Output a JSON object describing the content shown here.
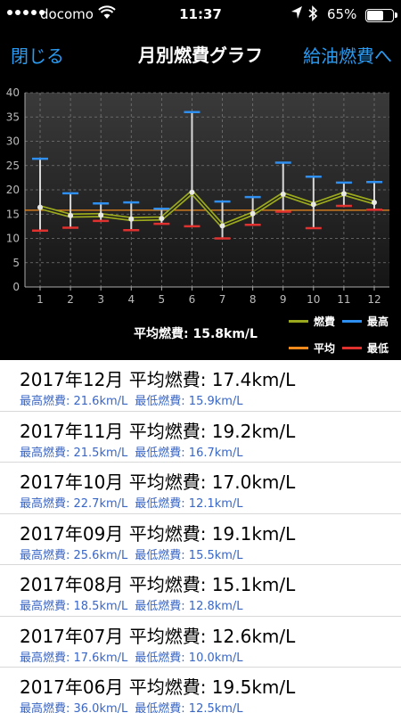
{
  "status": {
    "carrier": "docomo",
    "time": "11:37",
    "battery": "65%",
    "battery_level": 0.65
  },
  "nav": {
    "close_label": "閉じる",
    "title": "月別燃費グラフ",
    "fuel_label": "給油燃費へ"
  },
  "chart_data": {
    "type": "line",
    "categories": [
      "1",
      "2",
      "3",
      "4",
      "5",
      "6",
      "7",
      "8",
      "9",
      "10",
      "11",
      "12"
    ],
    "ylim": [
      0,
      40
    ],
    "yticks": [
      0,
      5,
      10,
      15,
      20,
      25,
      30,
      35,
      40
    ],
    "average": 15.8,
    "series": [
      {
        "name": "燃費",
        "values": [
          16.4,
          14.7,
          14.8,
          14.0,
          14.1,
          19.5,
          12.6,
          15.1,
          19.1,
          17.0,
          19.2,
          17.4
        ],
        "color": "#9aa81e"
      },
      {
        "name": "最高",
        "values": [
          26.4,
          19.3,
          17.2,
          17.4,
          16.1,
          36.0,
          17.6,
          18.5,
          25.6,
          22.7,
          21.5,
          21.6
        ],
        "color": "#2f8ff0"
      },
      {
        "name": "最低",
        "values": [
          11.6,
          12.2,
          13.6,
          11.7,
          13.0,
          12.5,
          10.0,
          12.8,
          15.5,
          12.1,
          16.7,
          15.9
        ],
        "color": "#e0312f"
      }
    ],
    "average_color": "#f08a1c",
    "grid": true,
    "legend_position": "bottom-right"
  },
  "legend": {
    "avg_text": "平均燃費: 15.8km/L",
    "items": {
      "fuel": "燃費",
      "max": "最高",
      "avg": "平均",
      "min": "最低"
    }
  },
  "months": [
    {
      "head": "2017年12月 平均燃費: 17.4km/L",
      "max": "最高燃費: 21.6km/L",
      "min": "最低燃費: 15.9km/L"
    },
    {
      "head": "2017年11月 平均燃費: 19.2km/L",
      "max": "最高燃費: 21.5km/L",
      "min": "最低燃費: 16.7km/L"
    },
    {
      "head": "2017年10月 平均燃費: 17.0km/L",
      "max": "最高燃費: 22.7km/L",
      "min": "最低燃費: 12.1km/L"
    },
    {
      "head": "2017年09月 平均燃費: 19.1km/L",
      "max": "最高燃費: 25.6km/L",
      "min": "最低燃費: 15.5km/L"
    },
    {
      "head": "2017年08月 平均燃費: 15.1km/L",
      "max": "最高燃費: 18.5km/L",
      "min": "最低燃費: 12.8km/L"
    },
    {
      "head": "2017年07月 平均燃費: 12.6km/L",
      "max": "最高燃費: 17.6km/L",
      "min": "最低燃費: 10.0km/L"
    },
    {
      "head": "2017年06月 平均燃費: 19.5km/L",
      "max": "最高燃費: 36.0km/L",
      "min": "最低燃費: 12.5km/L"
    }
  ]
}
